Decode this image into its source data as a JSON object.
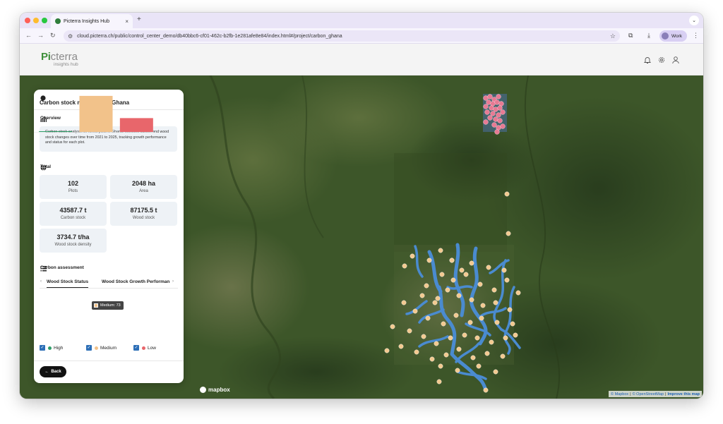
{
  "browser": {
    "tab_title": "Picterra Insights Hub",
    "url": "cloud.picterra.ch/public/control_center_demo/db40bbc6-cf01-462c-b2fb-1e281afe8e84/index.html#/project/carbon_ghana",
    "profile_label": "Work",
    "new_tab": "+",
    "close_tab": "×"
  },
  "app": {
    "logo_mark": "Pi",
    "logo_rest": "cterra",
    "logo_sub": "insights hub"
  },
  "panel": {
    "title": "Carbon stock monitoring - Ghana",
    "overview_heading": "Overview",
    "overview_text": "Carbon stock analysis for forest plots in Ghana. Monitors carbon and wood stock changes over time from 2021 to 2025, tracking growth performance and status for each plot.",
    "total_heading": "Total",
    "stats": [
      {
        "value": "102",
        "label": "Plots"
      },
      {
        "value": "2048 ha",
        "label": "Area"
      },
      {
        "value": "43587.7 t",
        "label": "Carbon stock"
      },
      {
        "value": "87175.5 t",
        "label": "Wood stock"
      },
      {
        "value": "3734.7 t/ha",
        "label": "Wood stock density"
      }
    ],
    "assessment_heading": "Carbon assessment",
    "tabs": [
      "Wood Stock Status",
      "Wood Stock Growth Performan"
    ],
    "tab_prev": "‹",
    "tab_next": "›",
    "tooltip": "Medium: 73",
    "legend": [
      {
        "label": "High",
        "color": "#2e9e6a"
      },
      {
        "label": "Medium",
        "color": "#f2c28a"
      },
      {
        "label": "Low",
        "color": "#e8666b"
      }
    ],
    "back_label": "Back"
  },
  "chart_data": {
    "type": "bar",
    "categories": [
      "High",
      "Medium",
      "Low"
    ],
    "values": [
      1,
      73,
      28
    ],
    "colors": [
      "#2e9e6a",
      "#f2c28a",
      "#e8666b"
    ],
    "ylim": [
      0,
      80
    ]
  },
  "map": {
    "brand": "mapbox",
    "attribution_mapbox": "© Mapbox",
    "attribution_osm": "© OpenStreetMap",
    "attribution_improve": "Improve this map",
    "separator": "|",
    "colors": {
      "river": "#4a8bd0",
      "plot": "#f3c98f",
      "cluster": "#e77a93"
    }
  }
}
